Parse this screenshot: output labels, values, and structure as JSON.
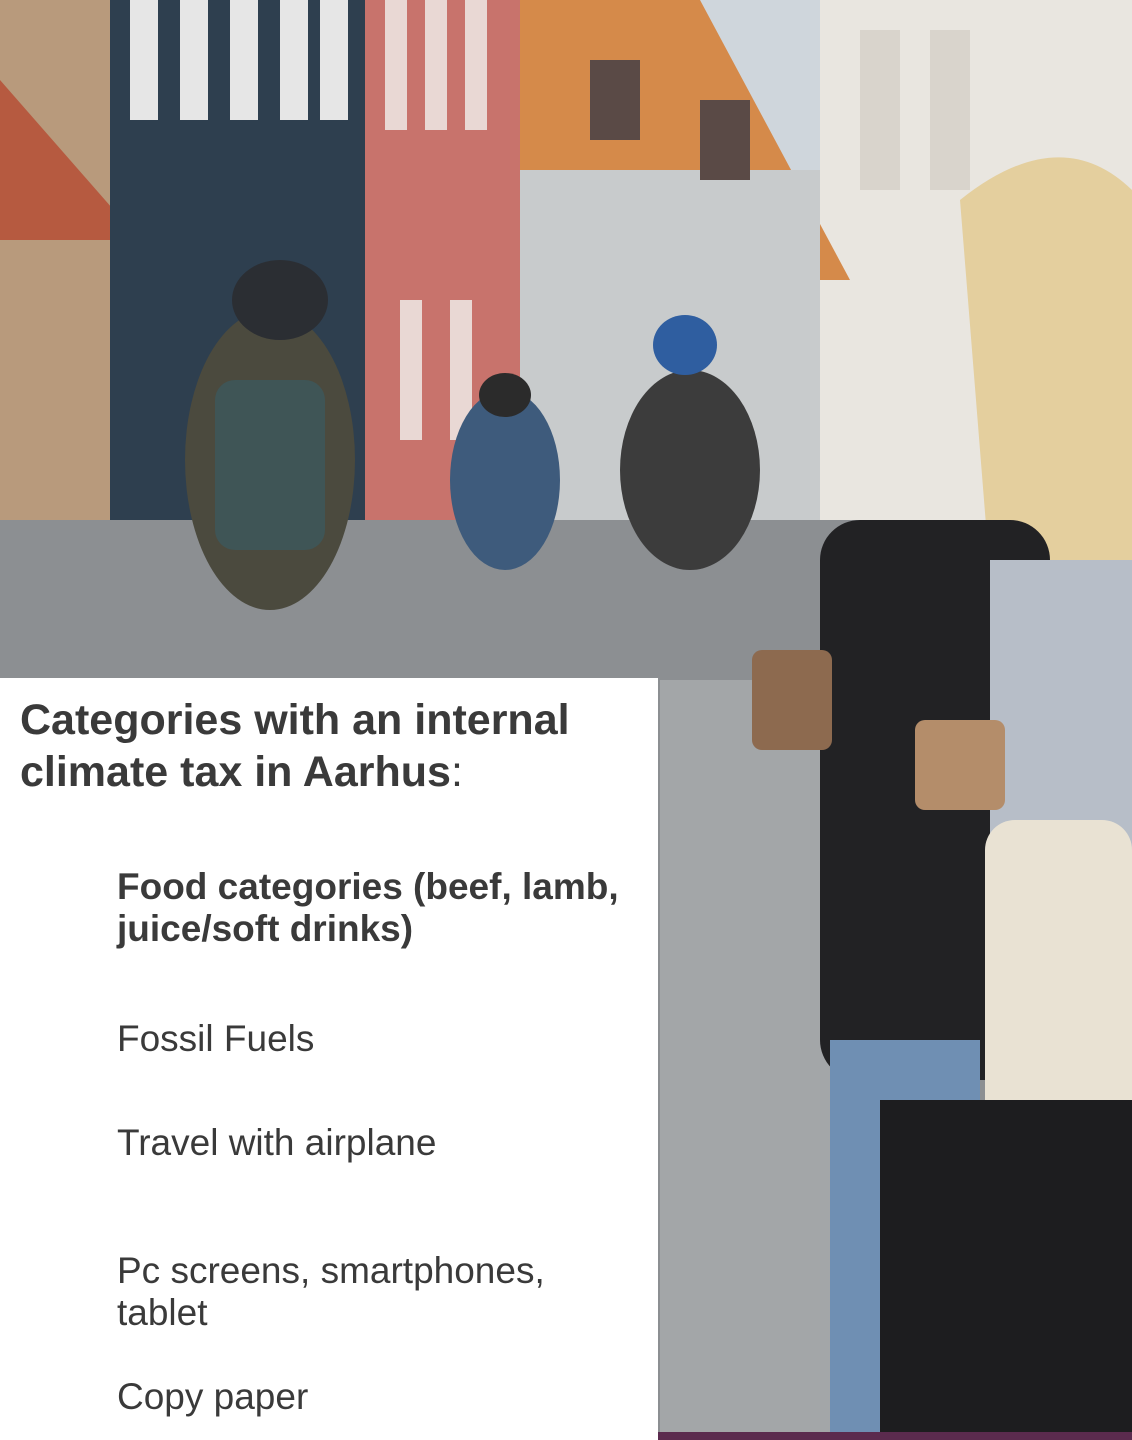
{
  "heading": {
    "bold": "Categories with an internal climate tax in Aarhus",
    "suffix": ":"
  },
  "categories": [
    "Food categories (beef, lamb, juice/soft drinks)",
    "Fossil Fuels",
    "Travel with airplane",
    "Pc screens, smartphones, tablet",
    "Copy paper"
  ],
  "colors": {
    "text": "#3a3a3a",
    "accent": "#5b2b4e",
    "panel": "#ffffff"
  }
}
